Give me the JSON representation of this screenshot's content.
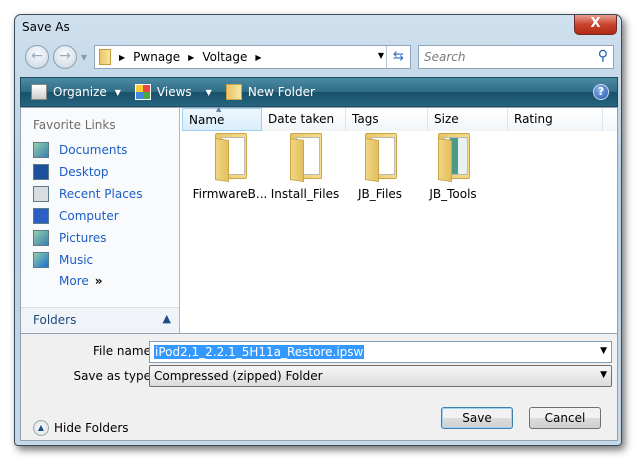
{
  "window": {
    "title": "Save As",
    "close": "X"
  },
  "nav": {
    "back": "←",
    "forward": "→",
    "breadcrumb": [
      "Pwnage",
      "Voltage"
    ],
    "search_placeholder": "Search"
  },
  "toolbar": {
    "organize": "Organize",
    "views": "Views",
    "new_folder": "New Folder",
    "help": "?"
  },
  "sidebar": {
    "heading": "Favorite Links",
    "links": [
      "Documents",
      "Desktop",
      "Recent Places",
      "Computer",
      "Pictures",
      "Music"
    ],
    "more": "More",
    "more_glyph": "»",
    "folders": "Folders"
  },
  "columns": [
    "Name",
    "Date taken",
    "Tags",
    "Size",
    "Rating"
  ],
  "items": [
    "FirmwareB...",
    "Install_Files",
    "JB_Files",
    "JB_Tools"
  ],
  "form": {
    "file_name_label": "File name:",
    "file_name": "iPod2,1_2.2.1_5H11a_Restore.ipsw",
    "type_label": "Save as type:",
    "type": "Compressed (zipped) Folder"
  },
  "footer": {
    "hide_folders": "Hide Folders",
    "save": "Save",
    "cancel": "Cancel"
  }
}
